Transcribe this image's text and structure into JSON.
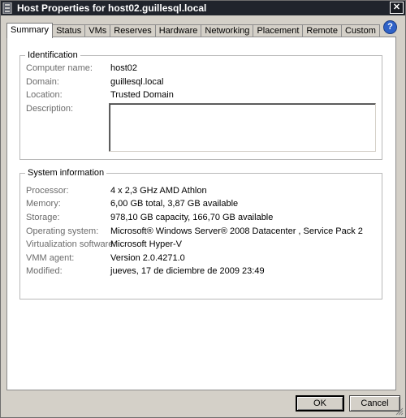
{
  "window": {
    "title": "Host Properties for host02.guillesql.local",
    "close_glyph": "✕"
  },
  "tabs": [
    {
      "label": "Summary",
      "active": true
    },
    {
      "label": "Status",
      "active": false
    },
    {
      "label": "VMs",
      "active": false
    },
    {
      "label": "Reserves",
      "active": false
    },
    {
      "label": "Hardware",
      "active": false
    },
    {
      "label": "Networking",
      "active": false
    },
    {
      "label": "Placement",
      "active": false
    },
    {
      "label": "Remote",
      "active": false
    },
    {
      "label": "Custom",
      "active": false
    }
  ],
  "help_glyph": "?",
  "identification": {
    "legend": "Identification",
    "computer_name_label": "Computer name:",
    "computer_name_value": "host02",
    "domain_label": "Domain:",
    "domain_value": "guillesql.local",
    "location_label": "Location:",
    "location_value": "Trusted Domain",
    "description_label": "Description:",
    "description_value": ""
  },
  "system_information": {
    "legend": "System information",
    "processor_label": "Processor:",
    "processor_value": "4 x 2,3 GHz  AMD  Athlon",
    "memory_label": "Memory:",
    "memory_value": "6,00 GB total, 3,87 GB available",
    "storage_label": "Storage:",
    "storage_value": "978,10 GB capacity, 166,70 GB available",
    "os_label": "Operating system:",
    "os_value": "Microsoft® Windows Server® 2008 Datacenter , Service Pack 2",
    "virtualization_label": "Virtualization software:",
    "virtualization_value": "Microsoft Hyper-V",
    "vmm_agent_label": "VMM agent:",
    "vmm_agent_value": "Version 2.0.4271.0",
    "modified_label": "Modified:",
    "modified_value": "jueves, 17 de diciembre de 2009 23:49"
  },
  "buttons": {
    "ok_label": "OK",
    "cancel_label": "Cancel"
  },
  "colors": {
    "titlebar": "#20242c",
    "dialog_face": "#d4d0c8",
    "panel": "#ffffff",
    "label_text": "#6b6b6b",
    "help_icon": "#2f62c8"
  }
}
